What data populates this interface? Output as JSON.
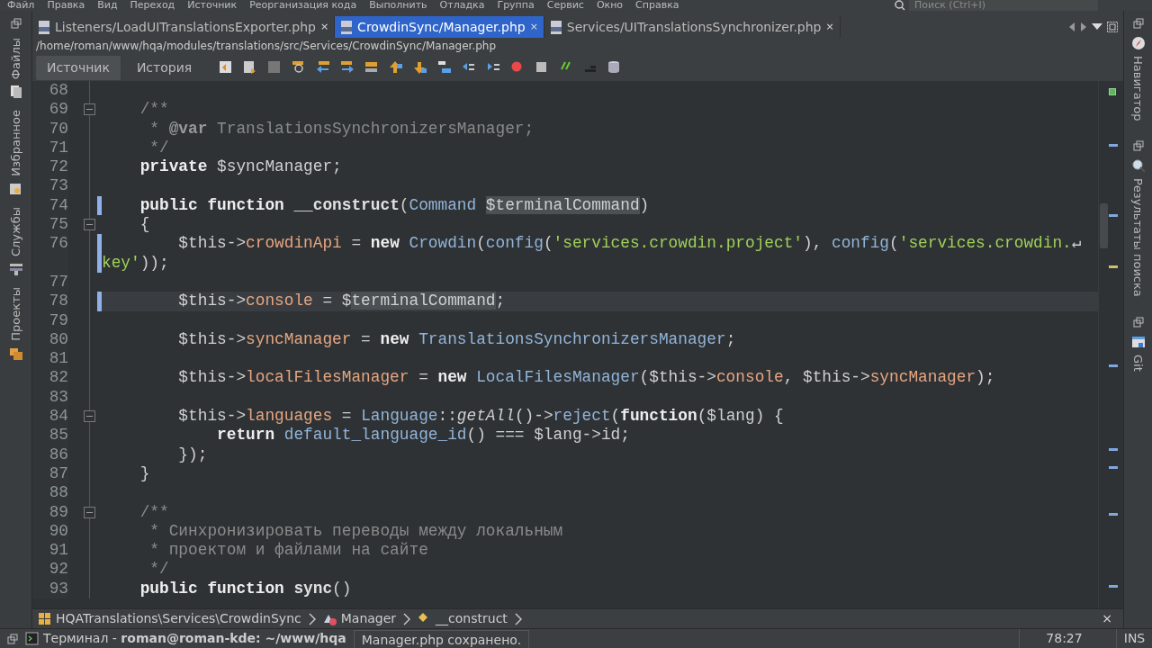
{
  "menu": [
    "Файл",
    "Правка",
    "Вид",
    "Переход",
    "Источник",
    "Реорганизация кода",
    "Выполнить",
    "Отладка",
    "Группа",
    "Сервис",
    "Окно",
    "Справка"
  ],
  "search": {
    "placeholder": "Поиск (Ctrl+I)"
  },
  "left_sidebar": [
    {
      "label": "Файлы"
    },
    {
      "label": "Избранное"
    },
    {
      "label": "Службы"
    },
    {
      "label": "Проекты"
    }
  ],
  "tabs": [
    {
      "label": "Listeners/LoadUITranslationsExporter.php",
      "close": "×",
      "selected": false
    },
    {
      "label": "CrowdinSync/Manager.php",
      "close": "×",
      "selected": true
    },
    {
      "label": "Services/UITranslationsSynchronizer.php",
      "close": "×",
      "selected": false
    }
  ],
  "file_path": "/home/roman/www/hqa/modules/translations/src/Services/CrowdinSync/Manager.php",
  "view_toggle": [
    {
      "label": "Источник",
      "selected": true
    },
    {
      "label": "История",
      "selected": false
    }
  ],
  "editor": {
    "lines": [
      {
        "number": "68",
        "changed": false,
        "foldable": false,
        "current": false
      },
      {
        "number": "69",
        "changed": false,
        "foldable": true,
        "current": false,
        "tokens": [
          {
            "kind": "cmt",
            "text": "    /**"
          }
        ]
      },
      {
        "number": "70",
        "changed": false,
        "foldable": false,
        "current": false,
        "tokens": [
          {
            "kind": "cmt",
            "text": "     * "
          },
          {
            "kind": "tag",
            "text": "@var"
          },
          {
            "kind": "cmt",
            "text": " TranslationsSynchronizersManager;"
          }
        ]
      },
      {
        "number": "71",
        "changed": false,
        "foldable": false,
        "current": false,
        "tokens": [
          {
            "kind": "cmt",
            "text": "     */"
          }
        ]
      },
      {
        "number": "72",
        "changed": false,
        "foldable": false,
        "current": false,
        "tokens": [
          {
            "kind": "kw",
            "text": "    private"
          },
          {
            "kind": "var",
            "text": " $syncManager;"
          }
        ]
      },
      {
        "number": "73",
        "changed": false,
        "foldable": false,
        "current": false
      },
      {
        "number": "74",
        "changed": true,
        "foldable": false,
        "current": false,
        "tokens": [
          {
            "kind": "kw",
            "text": "    public function "
          },
          {
            "kind": "fn",
            "text": "__construct"
          },
          {
            "kind": "plain",
            "text": "("
          },
          {
            "kind": "cls",
            "text": "Command "
          },
          {
            "kind": "hl",
            "text": "$terminalCommand"
          },
          {
            "kind": "plain",
            "text": ")"
          }
        ]
      },
      {
        "number": "75",
        "changed": false,
        "foldable": true,
        "current": false,
        "tokens": [
          {
            "kind": "plain",
            "text": "    {"
          }
        ]
      },
      {
        "number": "76",
        "changed": true,
        "foldable": false,
        "current": false,
        "tokens": [
          {
            "kind": "var",
            "text": "        $this->"
          },
          {
            "kind": "prop",
            "text": "crowdinApi"
          },
          {
            "kind": "plain",
            "text": " = "
          },
          {
            "kind": "kw",
            "text": "new "
          },
          {
            "kind": "cls",
            "text": "Crowdin"
          },
          {
            "kind": "plain",
            "text": "("
          },
          {
            "kind": "cls",
            "text": "config"
          },
          {
            "kind": "plain",
            "text": "("
          },
          {
            "kind": "str",
            "text": "'services.crowdin.project'"
          },
          {
            "kind": "plain",
            "text": "), "
          },
          {
            "kind": "cls",
            "text": "config"
          },
          {
            "kind": "plain",
            "text": "("
          },
          {
            "kind": "str",
            "text": "'services.crowdin."
          },
          {
            "kind": "wrap",
            "text": "↵"
          }
        ],
        "continuation": [
          {
            "kind": "str",
            "text": "key'"
          },
          {
            "kind": "plain",
            "text": "));"
          }
        ]
      },
      {
        "number": "77",
        "changed": false,
        "foldable": false,
        "current": false
      },
      {
        "number": "78",
        "changed": true,
        "foldable": false,
        "current": true,
        "tokens": [
          {
            "kind": "var",
            "text": "        $this->"
          },
          {
            "kind": "prop",
            "text": "console"
          },
          {
            "kind": "plain",
            "text": " = "
          },
          {
            "kind": "var",
            "text": "$"
          },
          {
            "kind": "hl",
            "text": "terminalCommand"
          },
          {
            "kind": "plain",
            "text": ";"
          }
        ]
      },
      {
        "number": "79",
        "changed": false,
        "foldable": false,
        "current": false
      },
      {
        "number": "80",
        "changed": false,
        "foldable": false,
        "current": false,
        "tokens": [
          {
            "kind": "var",
            "text": "        $this->"
          },
          {
            "kind": "prop",
            "text": "syncManager"
          },
          {
            "kind": "plain",
            "text": " = "
          },
          {
            "kind": "kw",
            "text": "new "
          },
          {
            "kind": "cls",
            "text": "TranslationsSynchronizersManager"
          },
          {
            "kind": "plain",
            "text": ";"
          }
        ]
      },
      {
        "number": "81",
        "changed": false,
        "foldable": false,
        "current": false
      },
      {
        "number": "82",
        "changed": false,
        "foldable": false,
        "current": false,
        "tokens": [
          {
            "kind": "var",
            "text": "        $this->"
          },
          {
            "kind": "prop",
            "text": "localFilesManager"
          },
          {
            "kind": "plain",
            "text": " = "
          },
          {
            "kind": "kw",
            "text": "new "
          },
          {
            "kind": "cls",
            "text": "LocalFilesManager"
          },
          {
            "kind": "plain",
            "text": "("
          },
          {
            "kind": "var",
            "text": "$this->"
          },
          {
            "kind": "prop",
            "text": "console"
          },
          {
            "kind": "plain",
            "text": ", "
          },
          {
            "kind": "var",
            "text": "$this->"
          },
          {
            "kind": "prop",
            "text": "syncManager"
          },
          {
            "kind": "plain",
            "text": ");"
          }
        ]
      },
      {
        "number": "83",
        "changed": false,
        "foldable": false,
        "current": false
      },
      {
        "number": "84",
        "changed": false,
        "foldable": true,
        "current": false,
        "tokens": [
          {
            "kind": "var",
            "text": "        $this->"
          },
          {
            "kind": "prop",
            "text": "languages"
          },
          {
            "kind": "plain",
            "text": " = "
          },
          {
            "kind": "cls",
            "text": "Language"
          },
          {
            "kind": "plain",
            "text": "::"
          },
          {
            "kind": "it",
            "text": "getAll"
          },
          {
            "kind": "plain",
            "text": "()->"
          },
          {
            "kind": "cls",
            "text": "reject"
          },
          {
            "kind": "plain",
            "text": "("
          },
          {
            "kind": "kw",
            "text": "function"
          },
          {
            "kind": "var",
            "text": "($lang)"
          },
          {
            "kind": "plain",
            "text": " {"
          }
        ]
      },
      {
        "number": "85",
        "changed": false,
        "foldable": false,
        "current": false,
        "tokens": [
          {
            "kind": "kw",
            "text": "            return "
          },
          {
            "kind": "cls",
            "text": "default_language_id"
          },
          {
            "kind": "plain",
            "text": "() === "
          },
          {
            "kind": "var",
            "text": "$lang->id"
          },
          {
            "kind": "plain",
            "text": ";"
          }
        ]
      },
      {
        "number": "86",
        "changed": false,
        "foldable": false,
        "current": false,
        "tokens": [
          {
            "kind": "plain",
            "text": "        });"
          }
        ]
      },
      {
        "number": "87",
        "changed": false,
        "foldable": false,
        "current": false,
        "tokens": [
          {
            "kind": "plain",
            "text": "    }"
          }
        ]
      },
      {
        "number": "88",
        "changed": false,
        "foldable": false,
        "current": false
      },
      {
        "number": "89",
        "changed": false,
        "foldable": true,
        "current": false,
        "tokens": [
          {
            "kind": "cmt",
            "text": "    /**"
          }
        ]
      },
      {
        "number": "90",
        "changed": false,
        "foldable": false,
        "current": false,
        "tokens": [
          {
            "kind": "cmt",
            "text": "     * Синхронизировать переводы между локальным"
          }
        ]
      },
      {
        "number": "91",
        "changed": false,
        "foldable": false,
        "current": false,
        "tokens": [
          {
            "kind": "cmt",
            "text": "     * проектом и файлами на сайте"
          }
        ]
      },
      {
        "number": "92",
        "changed": false,
        "foldable": false,
        "current": false,
        "tokens": [
          {
            "kind": "cmt",
            "text": "     */"
          }
        ]
      },
      {
        "number": "93",
        "changed": false,
        "foldable": false,
        "current": false,
        "tokens": [
          {
            "kind": "kw",
            "text": "    public function "
          },
          {
            "kind": "fn",
            "text": "sync"
          },
          {
            "kind": "plain",
            "text": "()"
          }
        ]
      }
    ]
  },
  "right_sidebar": [
    {
      "label": "Навигатор",
      "kind": "navigator"
    },
    {
      "label": "Результаты поиска",
      "kind": "search"
    },
    {
      "label": "Git",
      "kind": "git"
    }
  ],
  "breadcrumb": {
    "items": [
      {
        "label": "HQATranslations\\Services\\CrowdinSync",
        "kind": "package"
      },
      {
        "label": "Manager",
        "kind": "class"
      },
      {
        "label": "__construct",
        "kind": "method"
      }
    ],
    "close": "×"
  },
  "status_bar": {
    "terminal": "Терминал - **roman@roman-kde: ~/www/hqa**",
    "message": "Manager.php сохранено.",
    "position": "78:27",
    "mode": "INS"
  }
}
